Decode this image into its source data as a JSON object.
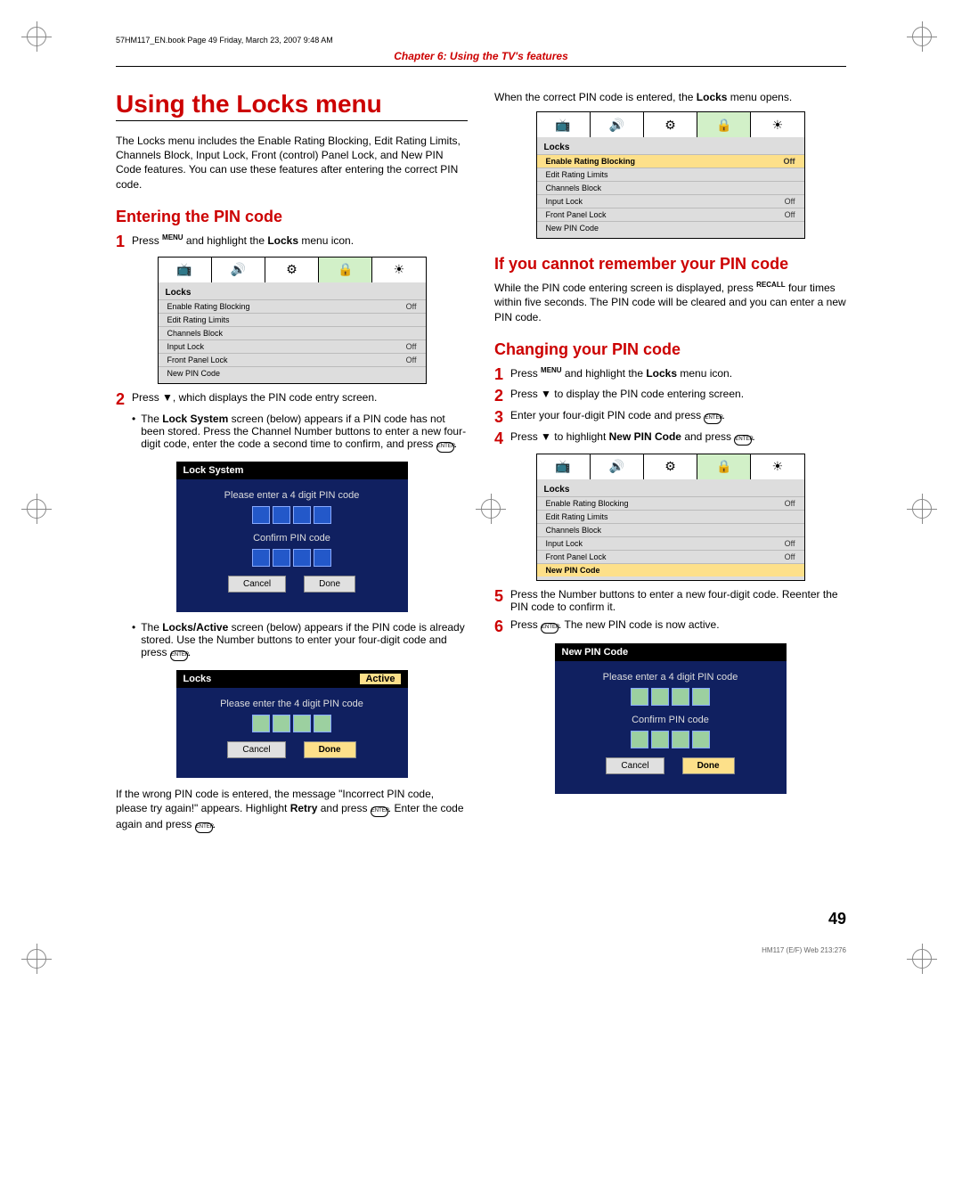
{
  "header_info": "57HM117_EN.book  Page 49  Friday, March 23, 2007  9:48 AM",
  "chapter": "Chapter 6: Using the TV's features",
  "h1": "Using the Locks menu",
  "intro": "The Locks menu includes the Enable Rating Blocking, Edit Rating Limits, Channels Block, Input Lock, Front (control) Panel Lock, and New PIN Code features. You can use these features after entering the correct PIN code.",
  "entering_h2": "Entering the PIN code",
  "steps_entering": {
    "s1a": "Press ",
    "s1_key": "MENU",
    "s1b": " and highlight the ",
    "s1_locks": "Locks",
    "s1c": " menu icon.",
    "s2": "Press ▼, which displays the PIN code entry screen.",
    "b1a": "The ",
    "b1_bold": "Lock System",
    "b1b": " screen (below) appears if a PIN code has not been stored. Press the Channel Number buttons to enter a new four-digit code, enter the code a second time to confirm, and press ",
    "b2a": "The ",
    "b2_bold": "Locks/Active",
    "b2b": " screen (below) appears if the PIN code is already stored. Use the Number buttons to enter your four-digit code and press "
  },
  "wrong1": "If the wrong PIN code is entered, the message \"Incorrect PIN code, please try again!\" appears. Highlight ",
  "wrong_bold": "Retry",
  "wrong2": " and press ",
  "wrong3": ". Enter the code again and press ",
  "right1": "When the correct PIN code is entered, the ",
  "right_bold": "Locks",
  "right2": " menu opens.",
  "forget_h2": "If you cannot remember your PIN code",
  "forget1": "While the PIN code entering screen is displayed, press ",
  "forget_key": "RECALL",
  "forget2": " four times within five seconds. The PIN code will be cleared and you can enter a new PIN code.",
  "change_h2": "Changing your PIN code",
  "change": {
    "s1a": "Press ",
    "s1_key": "MENU",
    "s1b": " and highlight the ",
    "s1_bold": "Locks",
    "s1c": " menu icon.",
    "s2": "Press ▼ to display the PIN code entering screen.",
    "s3": "Enter your four-digit PIN code and press ",
    "s4a": "Press ▼ to highlight ",
    "s4_bold": "New PIN Code",
    "s4b": " and press ",
    "s5": "Press the Number buttons to enter a new four-digit code. Reenter the PIN code to confirm it.",
    "s6a": "Press ",
    "s6b": ". The new PIN code is now active."
  },
  "osd": {
    "title": "Locks",
    "tabs": [
      "📺",
      "🔊",
      "⚙",
      "🔒",
      "☀"
    ],
    "rows": [
      {
        "label": "Enable Rating Blocking",
        "val": "Off"
      },
      {
        "label": "Edit Rating Limits",
        "val": ""
      },
      {
        "label": "Channels Block",
        "val": ""
      },
      {
        "label": "Input Lock",
        "val": "Off"
      },
      {
        "label": "Front Panel Lock",
        "val": "Off"
      },
      {
        "label": "New PIN Code",
        "val": ""
      }
    ]
  },
  "lock_system_dialog": {
    "title": "Lock System",
    "p1": "Please enter a 4 digit PIN code",
    "p2": "Confirm PIN code",
    "b_cancel": "Cancel",
    "b_done": "Done"
  },
  "locks_active_dialog": {
    "title": "Locks",
    "status": "Active",
    "p1": "Please enter the 4 digit PIN code",
    "b_cancel": "Cancel",
    "b_done": "Done"
  },
  "new_pin_dialog": {
    "title": "New PIN Code",
    "p1": "Please enter a 4 digit PIN code",
    "p2": "Confirm PIN code",
    "b_cancel": "Cancel",
    "b_done": "Done"
  },
  "enter_label": "ENTER",
  "period": ".",
  "page_num": "49",
  "footer": "HM117 (E/F) Web 213:276"
}
